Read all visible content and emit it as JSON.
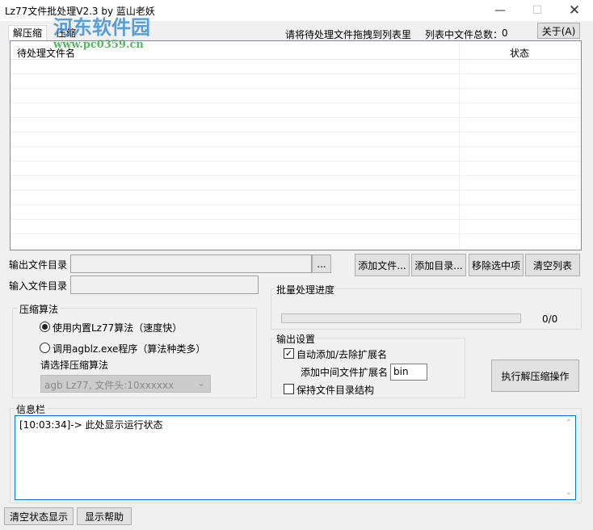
{
  "window": {
    "title": "Lz77文件批处理V2.3 by 蓝山老妖",
    "watermark": {
      "name": "河东软件园",
      "url": "www.pc0359.cn"
    }
  },
  "tabs": [
    {
      "label": "解压缩",
      "active": true
    },
    {
      "label": "压缩",
      "active": false
    }
  ],
  "hint": "请将待处理文件拖拽到列表里",
  "file_count_label": "列表中文件总数：",
  "file_count": "0",
  "about_button": "关于(A)",
  "list": {
    "columns": [
      "待处理文件名",
      "状态"
    ],
    "rows": []
  },
  "output_dir": {
    "label": "输出文件目录",
    "value": "",
    "browse": "..."
  },
  "input_dir": {
    "label": "输入文件目录",
    "value": ""
  },
  "buttons": {
    "add_file": "添加文件...",
    "add_dir": "添加目录...",
    "remove_selected": "移除选中项",
    "clear_list": "清空列表",
    "execute": "执行解压缩操作",
    "clear_status": "清空状态显示",
    "help": "显示帮助"
  },
  "algorithm": {
    "title": "压缩算法",
    "option1": "使用内置Lz77算法（速度快）",
    "option2": "调用agblz.exe程序（算法种类多）",
    "selected": 1,
    "select_label": "请选择压缩算法",
    "select_value": "agb Lz77, 文件头:10xxxxxx"
  },
  "progress": {
    "title": "批量处理进度",
    "value": 0,
    "text": "0/0"
  },
  "output_settings": {
    "title": "输出设置",
    "auto_ext": "自动添加/去除扩展名",
    "auto_ext_checked": true,
    "mid_ext_label": "添加中间文件扩展名",
    "mid_ext_value": "bin",
    "keep_structure": "保持文件目录结构",
    "keep_structure_checked": false
  },
  "info": {
    "title": "信息栏",
    "log": "[10:03:34]-> 此处显示运行状态"
  }
}
